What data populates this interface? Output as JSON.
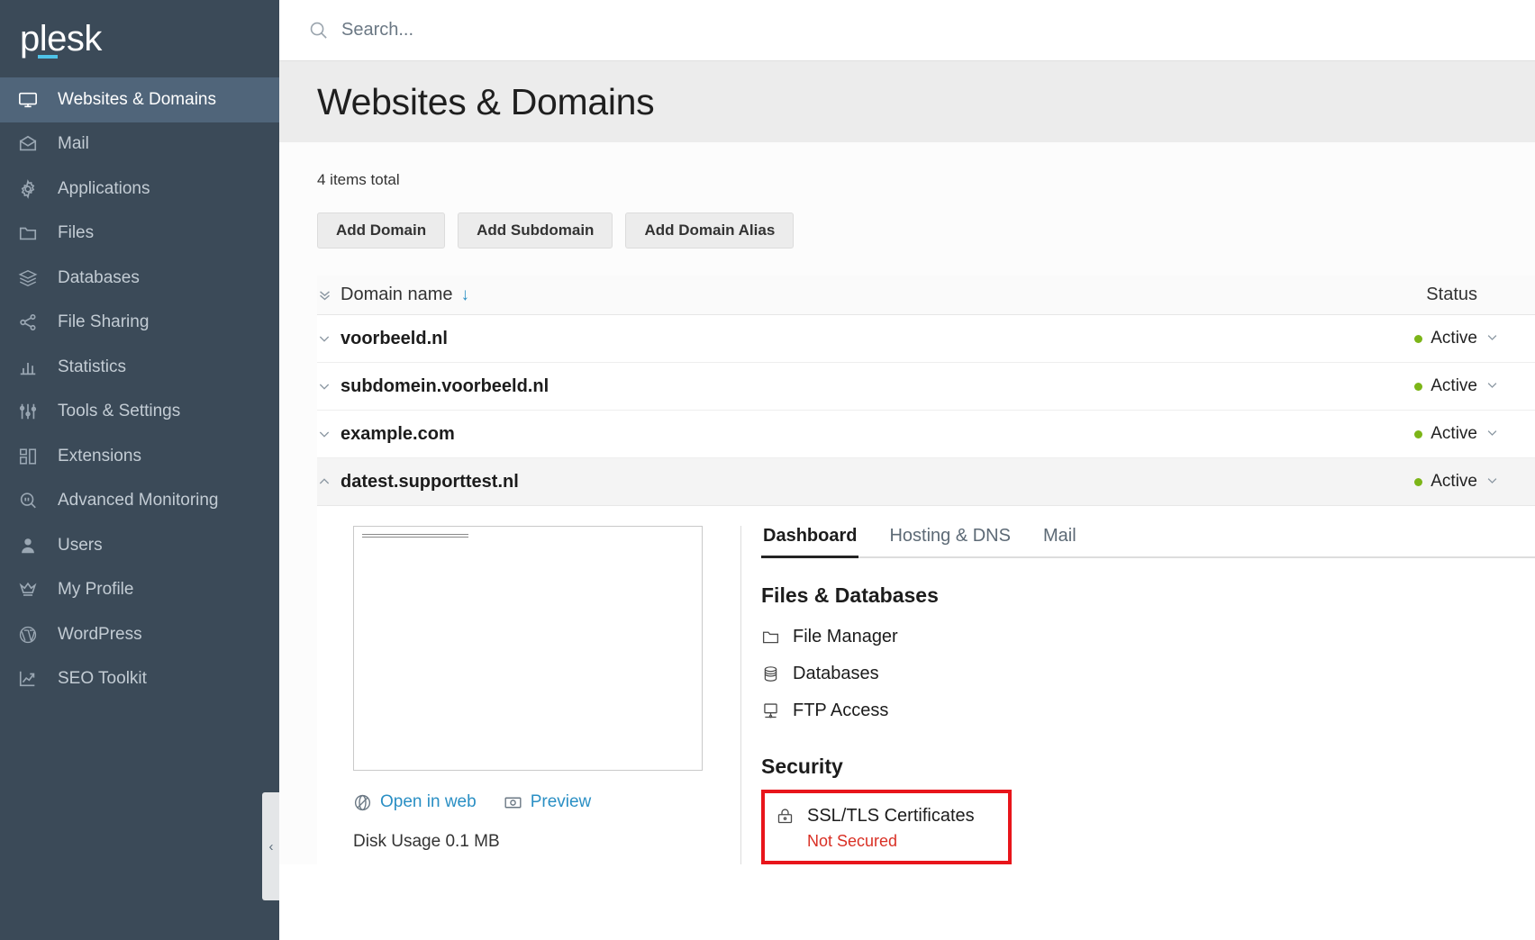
{
  "sidebar": {
    "logo": "plesk",
    "items": [
      {
        "label": "Websites & Domains",
        "icon": "monitor-icon",
        "active": true
      },
      {
        "label": "Mail",
        "icon": "mail-icon",
        "active": false
      },
      {
        "label": "Applications",
        "icon": "gear-icon",
        "active": false
      },
      {
        "label": "Files",
        "icon": "folder-icon",
        "active": false
      },
      {
        "label": "Databases",
        "icon": "database-stack-icon",
        "active": false
      },
      {
        "label": "File Sharing",
        "icon": "share-icon",
        "active": false
      },
      {
        "label": "Statistics",
        "icon": "bar-chart-icon",
        "active": false
      },
      {
        "label": "Tools & Settings",
        "icon": "sliders-icon",
        "active": false
      },
      {
        "label": "Extensions",
        "icon": "blocks-icon",
        "active": false
      },
      {
        "label": "Advanced Monitoring",
        "icon": "magnifier-pulse-icon",
        "active": false
      },
      {
        "label": "Users",
        "icon": "user-icon",
        "active": false
      },
      {
        "label": "My Profile",
        "icon": "crown-icon",
        "active": false
      },
      {
        "label": "WordPress",
        "icon": "wordpress-icon",
        "active": false
      },
      {
        "label": "SEO Toolkit",
        "icon": "seo-chart-icon",
        "active": false
      }
    ],
    "collapse_glyph": "‹"
  },
  "search": {
    "placeholder": "Search...",
    "value": ""
  },
  "header": {
    "title": "Websites & Domains"
  },
  "toolbar": {
    "items_total": "4 items total",
    "add_domain": "Add Domain",
    "add_subdomain": "Add Subdomain",
    "add_domain_alias": "Add Domain Alias"
  },
  "table": {
    "col_name": "Domain name",
    "col_status": "Status",
    "sort_glyph": "↓",
    "expand_all_glyph": "ˇˇ",
    "rows": [
      {
        "domain": "voorbeeld.nl",
        "status": "Active",
        "expanded": false
      },
      {
        "domain": "subdomein.voorbeeld.nl",
        "status": "Active",
        "expanded": false
      },
      {
        "domain": "example.com",
        "status": "Active",
        "expanded": false
      },
      {
        "domain": "datest.supporttest.nl",
        "status": "Active",
        "expanded": true
      }
    ]
  },
  "detail": {
    "tabs": [
      {
        "label": "Dashboard",
        "active": true
      },
      {
        "label": "Hosting & DNS",
        "active": false
      },
      {
        "label": "Mail",
        "active": false
      }
    ],
    "preview": {
      "open_in_web": "Open in web",
      "preview": "Preview",
      "disk_usage_label": "Disk Usage",
      "disk_usage_value": "0.1 MB"
    },
    "files_section": {
      "title": "Files & Databases",
      "links": [
        {
          "label": "File Manager",
          "icon": "folder-icon"
        },
        {
          "label": "Databases",
          "icon": "database-icon"
        },
        {
          "label": "FTP Access",
          "icon": "ftp-monitor-icon"
        }
      ]
    },
    "security_section": {
      "title": "Security",
      "ssl_label": "SSL/TLS Certificates",
      "ssl_status": "Not Secured",
      "ssl_icon": "lock-certificate-icon"
    }
  },
  "colors": {
    "sidebar_bg": "#3b4a58",
    "sidebar_active": "#50657a",
    "accent_blue": "#2a8fc4",
    "status_green": "#7cb518",
    "alert_red": "#e8151b",
    "not_secured_red": "#d93025",
    "logo_underline": "#4fc3e8"
  }
}
